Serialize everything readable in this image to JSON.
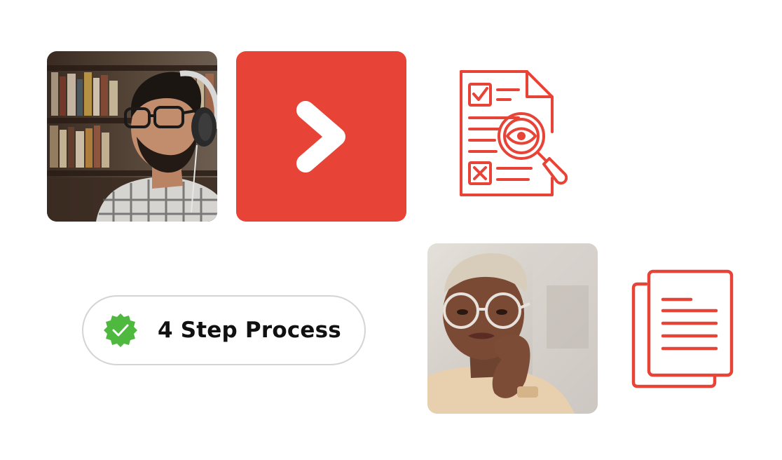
{
  "process_badge": {
    "label": "4 Step Process",
    "icon": "verified-check-badge-icon",
    "badge_color": "#4fb83f"
  },
  "next_tile": {
    "icon": "chevron-right-icon",
    "background_color": "#e84337"
  },
  "icons": {
    "review": "document-review-magnifier-icon",
    "documents": "stacked-documents-icon",
    "accent_color": "#e84337"
  },
  "photos": {
    "first": "man-with-headphones-photo",
    "second": "woman-with-glasses-photo"
  }
}
